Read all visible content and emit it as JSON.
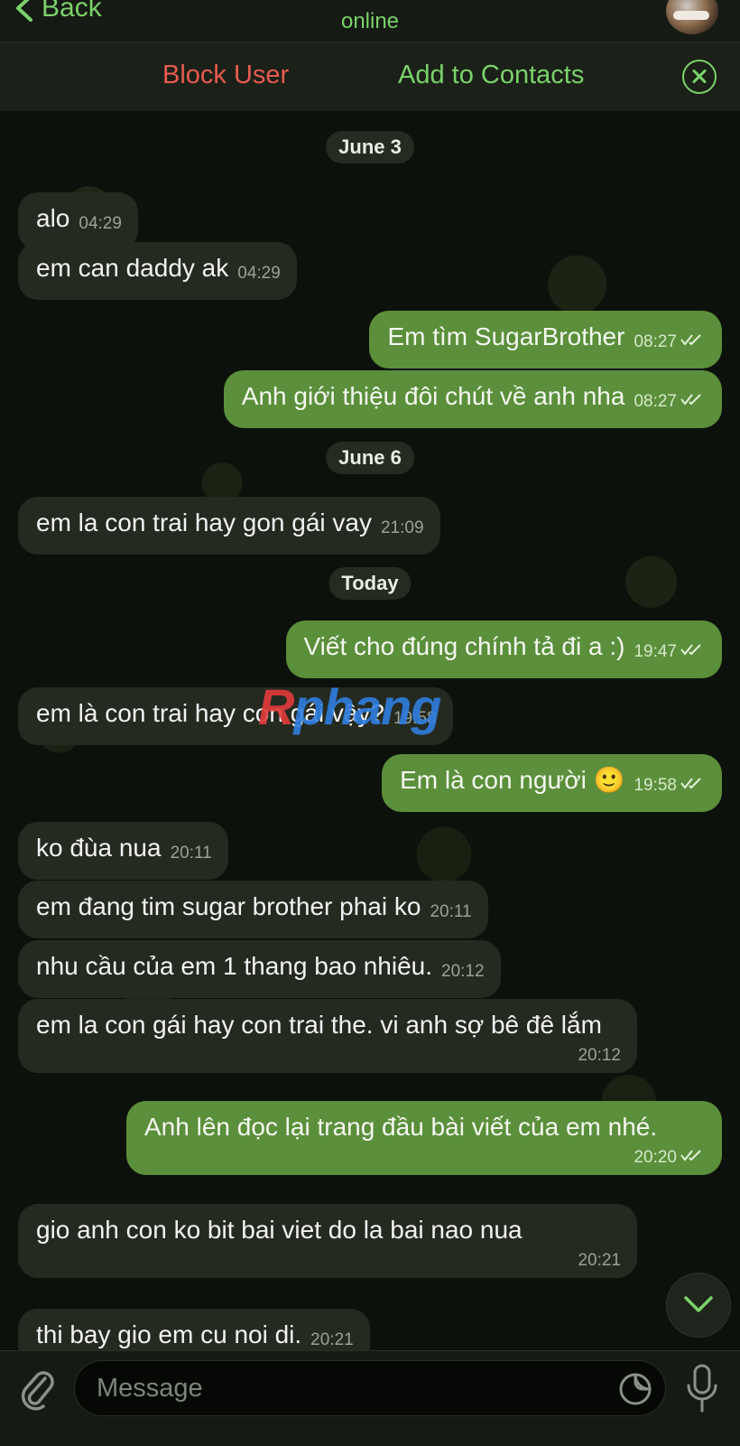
{
  "header": {
    "back_label": "Back",
    "status": "online"
  },
  "action_bar": {
    "block_label": "Block User",
    "add_label": "Add to Contacts"
  },
  "chat": {
    "dates": [
      "June 3",
      "June 6",
      "Today"
    ],
    "messages": [
      {
        "dir": "in",
        "text": "alo",
        "time": "04:29"
      },
      {
        "dir": "in",
        "text": "em can daddy ak",
        "time": "04:29"
      },
      {
        "dir": "out",
        "text": "Em tìm SugarBrother",
        "time": "08:27"
      },
      {
        "dir": "out",
        "text": "Anh giới thiệu đôi chút về anh nha",
        "time": "08:27"
      },
      {
        "dir": "in",
        "text": "em la con trai hay gon gái vay",
        "time": "21:09"
      },
      {
        "dir": "out",
        "text": "Viết cho đúng chính tả đi a :)",
        "time": "19:47"
      },
      {
        "dir": "in",
        "text": "em là con trai hay con gái vậy?",
        "time": "19:58"
      },
      {
        "dir": "out",
        "text": "Em là con người 🙂",
        "time": "19:58"
      },
      {
        "dir": "in",
        "text": "ko đùa nua",
        "time": "20:11"
      },
      {
        "dir": "in",
        "text": "em đang tim sugar brother phai ko",
        "time": "20:11"
      },
      {
        "dir": "in",
        "text": "nhu cầu của em 1 thang bao nhiêu.",
        "time": "20:12"
      },
      {
        "dir": "in",
        "text": "em la con gái hay con trai the. vi anh sợ bê đê lắm",
        "time": "20:12"
      },
      {
        "dir": "out",
        "text": "Anh lên đọc lại trang đầu bài viết của em nhé.",
        "time": "20:20"
      },
      {
        "dir": "in",
        "text": "gio anh con ko bit bai viet do la bai nao nua",
        "time": "20:21"
      },
      {
        "dir": "in",
        "text": "thi bay gio em cu noi di.",
        "time": "20:21"
      }
    ],
    "watermark": {
      "part1": "R",
      "part2": "phang"
    }
  },
  "input": {
    "placeholder": "Message"
  },
  "icons": {
    "back": "chevron-left-icon",
    "close": "close-circle-icon",
    "attach": "paperclip-icon",
    "sticker": "sticker-icon",
    "mic": "microphone-icon",
    "scroll": "chevron-down-icon",
    "read": "double-check-icon"
  },
  "colors": {
    "accent": "#7ad26a",
    "danger": "#e85b4f",
    "outgoing_bubble": "#5b8f3b",
    "incoming_bubble": "#252a21"
  }
}
